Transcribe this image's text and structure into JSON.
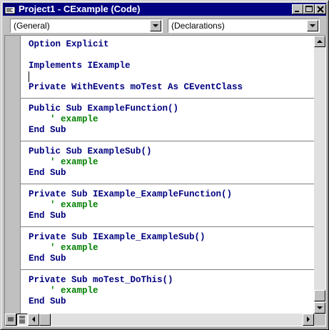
{
  "window": {
    "title": "Project1 - CExample (Code)",
    "title_bar_color": "#000080"
  },
  "toolbar": {
    "object_combo_value": "(General)",
    "procedure_combo_value": "(Declarations)"
  },
  "code": {
    "keyword_color": "#000080",
    "comment_color": "#008000",
    "lines": [
      "Option Explicit",
      "",
      "Implements IExample",
      "",
      "Private WithEvents moTest As CEventClass",
      "",
      "Public Sub ExampleFunction()",
      "    ' example",
      "End Sub",
      "",
      "Public Sub ExampleSub()",
      "    ' example",
      "End Sub",
      "",
      "Private Sub IExample_ExampleFunction()",
      "    ' example",
      "End Sub",
      "",
      "Private Sub IExample_ExampleSub()",
      "    ' example",
      "End Sub",
      "",
      "Private Sub moTest_DoThis()",
      "    ' example",
      "End Sub"
    ]
  }
}
